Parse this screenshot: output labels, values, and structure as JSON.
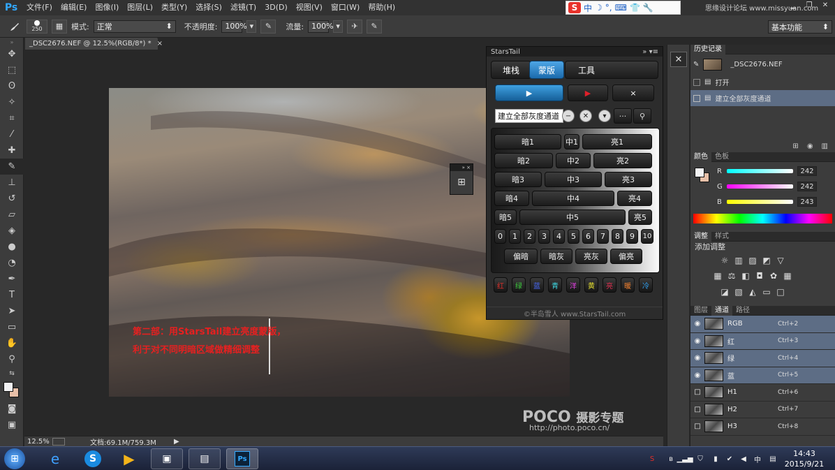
{
  "app": {
    "logo": "Ps",
    "accent": "#31a8ff"
  },
  "menu": [
    "文件(F)",
    "编辑(E)",
    "图像(I)",
    "图层(L)",
    "类型(Y)",
    "选择(S)",
    "滤镜(T)",
    "3D(D)",
    "视图(V)",
    "窗口(W)",
    "帮助(H)"
  ],
  "ime": {
    "brand": "S",
    "lang": "中",
    "glyphs": [
      "☽",
      "°,",
      "⌨",
      "👕",
      "🔧"
    ]
  },
  "top_watermark": "思缘设计论坛 www.missyuan.com",
  "window_controls": {
    "min": "▁",
    "max": "❐",
    "close": "✕"
  },
  "options": {
    "brush_size": "250",
    "mode_label": "模式:",
    "mode_value": "正常",
    "opacity_label": "不透明度:",
    "opacity_value": "100%",
    "flow_label": "流量:",
    "flow_value": "100%",
    "workspace": "基本功能"
  },
  "document": {
    "tab": "_DSC2676.NEF @ 12.5%(RGB/8*) *",
    "close": "×"
  },
  "photo_text": [
    "第二部：用StarsTail建立亮度蒙版，",
    "利于对不同明暗区域做精细调整"
  ],
  "poco": {
    "brand": "POCO",
    "subtitle": "摄影专题",
    "url": "http://photo.poco.cn/"
  },
  "status": {
    "zoom": "12.5%",
    "doc": "文档:69.1M/759.3M"
  },
  "starstail": {
    "title": "StarsTail",
    "tabs": [
      "堆栈",
      "蒙版",
      "工具"
    ],
    "selected_tab": 1,
    "play": [
      "▶",
      "▶",
      "×"
    ],
    "command": "建立全部灰度通道",
    "grid_rows": [
      [
        "暗1",
        "中1",
        "亮1"
      ],
      [
        "暗2",
        "中2",
        "亮2"
      ],
      [
        "暗3",
        "中3",
        "亮3"
      ],
      [
        "暗4",
        "中4",
        "亮4"
      ],
      [
        "暗5",
        "中5",
        "亮5"
      ]
    ],
    "numbers": [
      "0",
      "1",
      "2",
      "3",
      "4",
      "5",
      "6",
      "7",
      "8",
      "9",
      "10"
    ],
    "bottom": [
      "偏暗",
      "暗灰",
      "亮灰",
      "偏亮"
    ],
    "colors": [
      {
        "label": "红",
        "color": "#e0302a"
      },
      {
        "label": "绿",
        "color": "#3fcf3f"
      },
      {
        "label": "蓝",
        "color": "#4a6cff"
      },
      {
        "label": "青",
        "color": "#3fd6e0"
      },
      {
        "label": "洋",
        "color": "#e040e0"
      },
      {
        "label": "黄",
        "color": "#e6e030"
      },
      {
        "label": "亮",
        "color": "#e03050"
      },
      {
        "label": "暖",
        "color": "#f08030"
      },
      {
        "label": "冷",
        "color": "#30a0f0"
      }
    ],
    "footer": "©半岛雪人 www.StarsTail.com"
  },
  "history": {
    "tabs": [
      "历史记录"
    ],
    "snapshot": "_DSC2676.NEF",
    "items": [
      "打开",
      "建立全部灰度通道"
    ]
  },
  "color_panel": {
    "tabs": [
      "颜色",
      "色板"
    ],
    "r": "242",
    "g": "242",
    "b": "243",
    "labels": [
      "R",
      "G",
      "B"
    ]
  },
  "adjust": {
    "tabs": [
      "调整",
      "样式"
    ],
    "title": "添加调整"
  },
  "channels": {
    "tabs": [
      "图层",
      "通道",
      "路径"
    ],
    "rows": [
      {
        "name": "RGB",
        "key": "Ctrl+2",
        "visible": true,
        "sel": true
      },
      {
        "name": "红",
        "key": "Ctrl+3",
        "visible": true,
        "sel": true
      },
      {
        "name": "绿",
        "key": "Ctrl+4",
        "visible": true,
        "sel": true
      },
      {
        "name": "蓝",
        "key": "Ctrl+5",
        "visible": true,
        "sel": true
      },
      {
        "name": "H1",
        "key": "Ctrl+6",
        "visible": false,
        "sel": false
      },
      {
        "name": "H2",
        "key": "Ctrl+7",
        "visible": false,
        "sel": false
      },
      {
        "name": "H3",
        "key": "Ctrl+8",
        "visible": false,
        "sel": false
      }
    ]
  },
  "clock": {
    "time": "14:43",
    "date": "2015/9/21"
  }
}
